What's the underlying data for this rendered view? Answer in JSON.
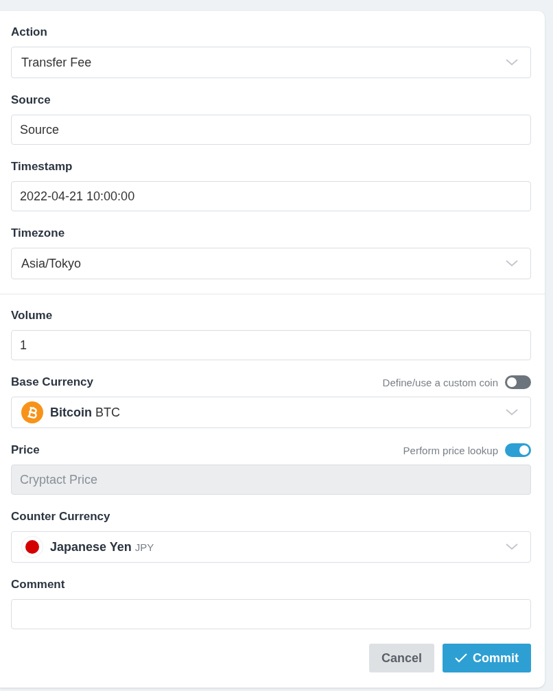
{
  "sections": [
    [
      {
        "kind": "select",
        "label": "Action",
        "value": "Transfer Fee"
      },
      {
        "kind": "text",
        "label": "Source",
        "value": "Source"
      },
      {
        "kind": "text",
        "label": "Timestamp",
        "value": "2022-04-21 10:00:00"
      },
      {
        "kind": "select",
        "label": "Timezone",
        "value": "Asia/Tokyo"
      }
    ],
    [
      {
        "kind": "text",
        "label": "Volume",
        "value": "1"
      },
      {
        "kind": "coin-select",
        "label": "Base Currency",
        "toggle": {
          "label": "Define/use a custom coin",
          "on": false
        },
        "coin": {
          "kind": "crypto",
          "color": "#f7931a",
          "name": "Bitcoin",
          "code": "BTC"
        }
      },
      {
        "kind": "disabled",
        "label": "Price",
        "toggle": {
          "label": "Perform price lookup",
          "on": true
        },
        "placeholder": "Cryptact Price"
      },
      {
        "kind": "coin-select",
        "label": "Counter Currency",
        "coin": {
          "kind": "fiat",
          "color": "#d40000",
          "name": "Japanese Yen",
          "code": "JPY"
        }
      },
      {
        "kind": "text",
        "label": "Comment"
      }
    ]
  ],
  "buttons": [
    {
      "kind": "secondary",
      "label": "Cancel"
    },
    {
      "kind": "primary",
      "label": "Commit"
    }
  ]
}
